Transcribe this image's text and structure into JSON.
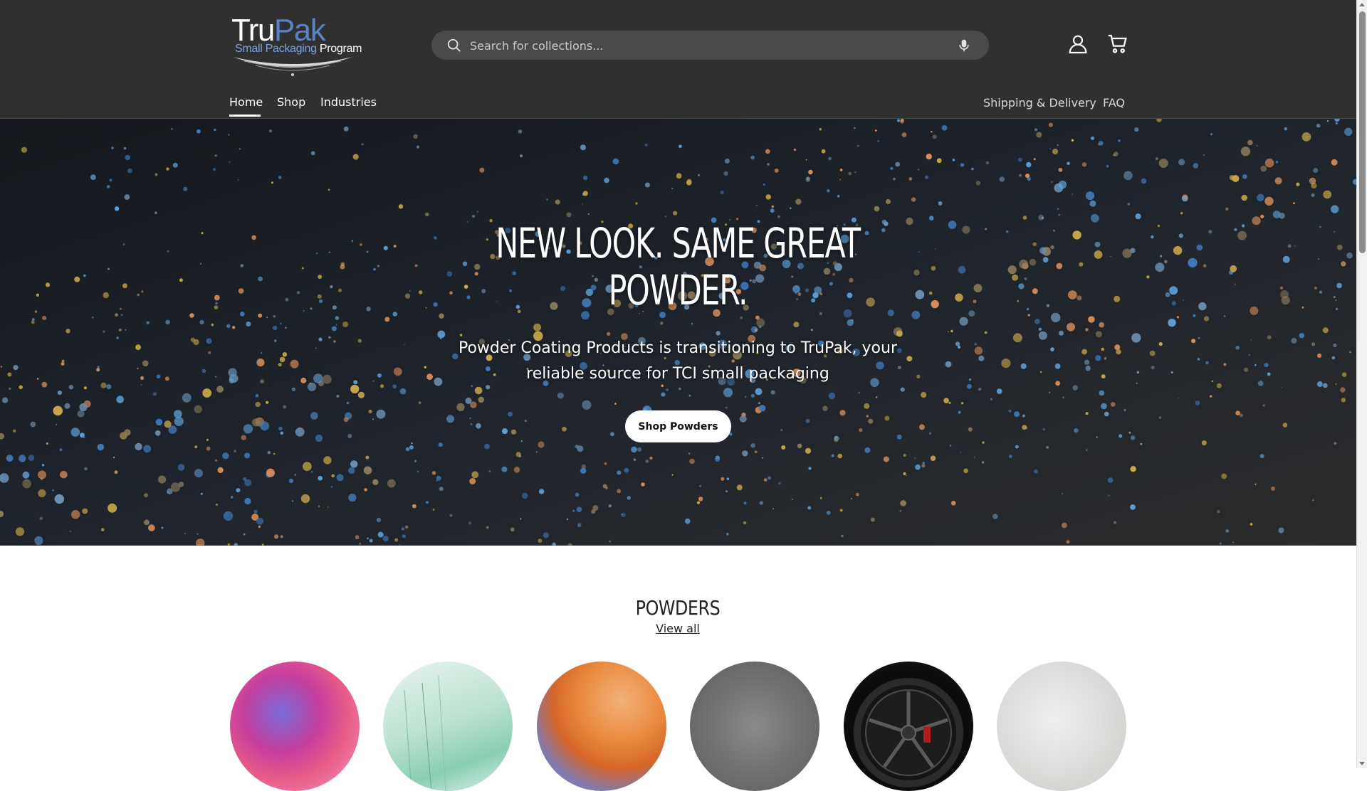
{
  "brand": {
    "logo_part1": "Tru",
    "logo_part2": "Pak",
    "tagline_part1": "Small Packaging",
    "tagline_part2": "Program"
  },
  "search": {
    "placeholder": "Search for collections...",
    "icon": "search-icon",
    "mic_icon": "microphone-icon"
  },
  "header_icons": {
    "account": "account-icon",
    "cart": "cart-icon"
  },
  "nav": {
    "left": [
      "Home",
      "Shop",
      "Industries"
    ],
    "active": "Home",
    "right": [
      "Shipping & Delivery",
      "FAQ"
    ]
  },
  "hero": {
    "title_line1": "NEW LOOK. SAME GREAT",
    "title_line2": "POWDER.",
    "subtitle_line1": "Powder Coating Products is transitioning to TruPak, your",
    "subtitle_line2": "reliable source for TCI small packaging",
    "button_label": "Shop Powders"
  },
  "powders": {
    "title": "POWDERS",
    "view_all": "View all",
    "categories": [
      "chameleon-powder",
      "clear-powder",
      "pigment-powder",
      "metallic-powder",
      "wheel-powder",
      "primer-powder"
    ]
  },
  "colors": {
    "header_bg": "#303030",
    "search_bg": "#4a4a4a",
    "logo_blue": "#5b82c2",
    "hero_blue": "#3f78b8",
    "hero_yellow": "#c9a84a",
    "hero_orange": "#d98e5a"
  }
}
